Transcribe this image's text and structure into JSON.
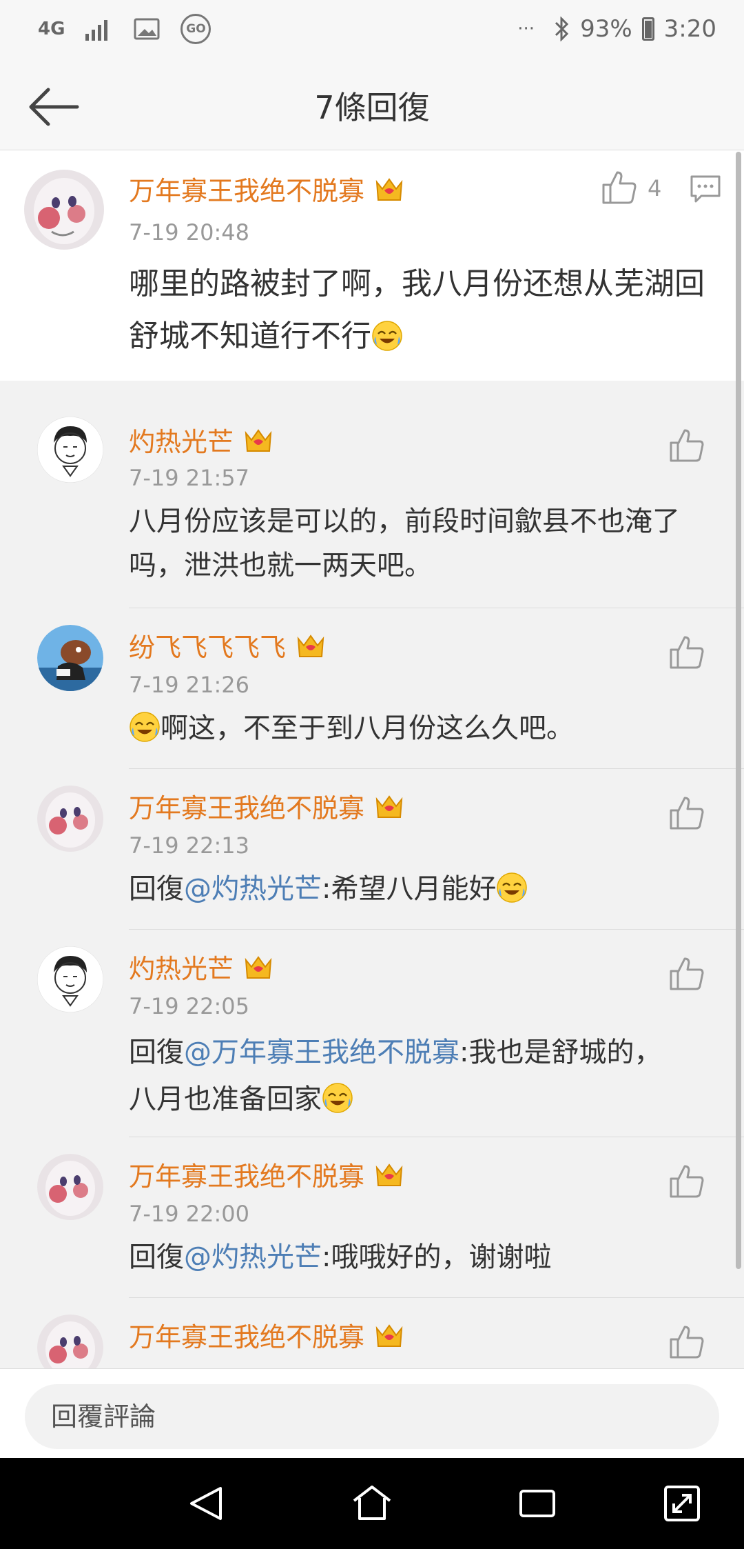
{
  "status_bar": {
    "network": "4G",
    "battery_percent": "93%",
    "time": "3:20",
    "more": "···",
    "go_label": "GO"
  },
  "header": {
    "title": "7條回復"
  },
  "top_comment": {
    "username": "万年寡王我绝不脱寡",
    "time": "7-19 20:48",
    "text": "哪里的路被封了啊，我八月份还想从芜湖回舒城不知道行不行",
    "like_count": "4"
  },
  "replies": [
    {
      "username": "灼热光芒",
      "time": "7-19 21:57",
      "text": "八月份应该是可以的，前段时间歙县不也淹了吗，泄洪也就一两天吧。"
    },
    {
      "username": "纷飞飞飞飞飞",
      "time": "7-19 21:26",
      "text": "啊这，不至于到八月份这么久吧。"
    },
    {
      "username": "万年寡王我绝不脱寡",
      "time": "7-19 22:13",
      "reply_prefix": "回復",
      "mention": "@灼热光芒",
      "text": ":希望八月能好"
    },
    {
      "username": "灼热光芒",
      "time": "7-19 22:05",
      "reply_prefix": "回復",
      "mention": "@万年寡王我绝不脱寡",
      "text": ":我也是舒城的，",
      "text_line2": "八月也准备回家"
    },
    {
      "username": "万年寡王我绝不脱寡",
      "time": "7-19 22:00",
      "reply_prefix": "回復",
      "mention": "@灼热光芒",
      "text": ":哦哦好的，谢谢啦"
    },
    {
      "username": "万年寡王我绝不脱寡"
    }
  ],
  "footer": {
    "reply_placeholder": "回覆評論"
  },
  "colors": {
    "username": "#e3791f",
    "mention": "#4d7eb5",
    "timestamp": "#999999"
  }
}
